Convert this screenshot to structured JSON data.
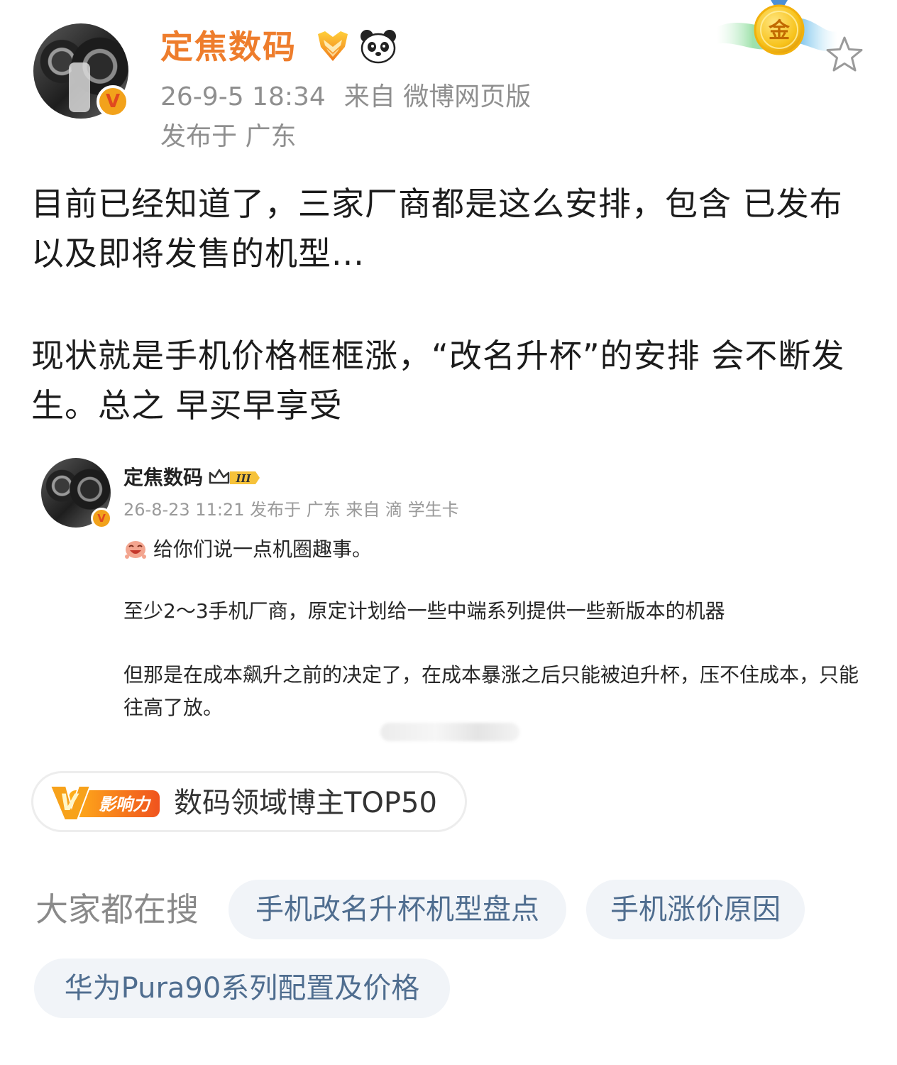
{
  "author": {
    "name": "定焦数码",
    "verified_mark": "V",
    "rank_icon": "rank-badge-icon",
    "extra_icon": "panda-icon"
  },
  "post": {
    "time": "26-9-5 18:34",
    "source": "来自 微博网页版",
    "location": "发布于 广东",
    "paragraph1": "目前已经知道了，三家厂商都是这么安排，包含 已发布以及即将发售的机型...",
    "paragraph2": "现状就是手机价格框框涨，“改名升杯”的安排 会不断发生。总之 早买早享受"
  },
  "medal": {
    "label": "金"
  },
  "quoted": {
    "name": "定焦数码",
    "rank_label": "III",
    "meta": "26-8-23 11:21 发布于 广东 来自 滴 学生卡",
    "line1": "给你们说一点机圈趣事。",
    "line2": "至少2～3手机厂商，原定计划给一些中端系列提供一些新版本的机器",
    "line3": "但那是在成本飙升之前的决定了，在成本暴涨之后只能被迫升杯，压不住成本，只能往高了放。"
  },
  "influence": {
    "badge_text": "影响力",
    "badge_letter": "V",
    "label": "数码领域博主TOP50"
  },
  "search": {
    "label": "大家都在搜",
    "chips": [
      "手机改名升杯机型盘点",
      "手机涨价原因",
      "华为Pura90系列配置及价格"
    ]
  },
  "colors": {
    "username": "#ee7d2c",
    "meta": "#8f8f8f",
    "chip_bg": "#f1f4f8",
    "chip_text": "#4f6d8f"
  }
}
